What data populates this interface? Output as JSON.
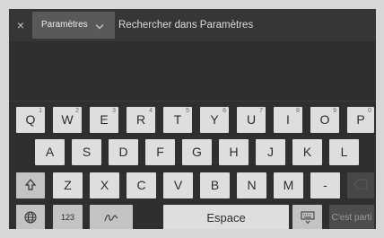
{
  "topbar": {
    "close_glyph": "×",
    "dropdown_label": "Paramètres",
    "search_placeholder": "Rechercher dans Paramètres"
  },
  "keyboard": {
    "row1": [
      {
        "label": "Q",
        "sup": "1"
      },
      {
        "label": "W",
        "sup": "2"
      },
      {
        "label": "E",
        "sup": "3"
      },
      {
        "label": "R",
        "sup": "4"
      },
      {
        "label": "T",
        "sup": "5"
      },
      {
        "label": "Y",
        "sup": "6"
      },
      {
        "label": "U",
        "sup": "7"
      },
      {
        "label": "I",
        "sup": "8"
      },
      {
        "label": "O",
        "sup": "9"
      },
      {
        "label": "P",
        "sup": "0"
      }
    ],
    "row2": [
      "A",
      "S",
      "D",
      "F",
      "G",
      "H",
      "J",
      "K",
      "L"
    ],
    "row3": [
      "Z",
      "X",
      "C",
      "V",
      "B",
      "N",
      "M",
      "-"
    ],
    "numbers_label": "123",
    "space_label": "Espace",
    "go_label": "C'est parti"
  },
  "icons": {
    "close": "close-icon",
    "dropdown": "chevron-down-icon",
    "shift": "shift-icon",
    "backspace": "backspace-icon",
    "language": "globe-icon",
    "handwriting": "handwriting-icon",
    "hide_keyboard": "keyboard-hide-icon"
  },
  "colors": {
    "screen_bg": "#2f2f2f",
    "key_bg": "#dedede",
    "function_key_bg": "#c3c3c3",
    "dropdown_bg": "#595959"
  }
}
